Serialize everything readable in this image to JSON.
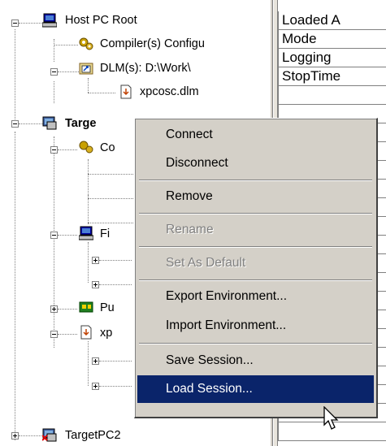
{
  "tree": {
    "host_root": "Host PC Root",
    "compiler_config": "Compiler(s) Configu",
    "dlm_folder": "DLM(s): D:\\Work\\",
    "dlm_file": "xpcosc.dlm",
    "target_root": "Targe",
    "target_child_c": "Co",
    "target_child_fi": "Fi",
    "target_child_pu": "Pu",
    "target_child_xp": "xp",
    "target_pc2": "TargetPC2"
  },
  "grid": {
    "rows": [
      "Loaded A",
      "Mode",
      "Logging",
      "StopTime"
    ]
  },
  "context_menu": {
    "items": [
      {
        "label": "Connect",
        "state": "normal"
      },
      {
        "label": "Disconnect",
        "state": "normal"
      },
      {
        "label": "Remove",
        "state": "normal"
      },
      {
        "label": "Rename",
        "state": "disabled"
      },
      {
        "label": "Set As Default",
        "state": "disabled"
      },
      {
        "label": "Export Environment...",
        "state": "normal"
      },
      {
        "label": "Import Environment...",
        "state": "normal"
      },
      {
        "label": "Save Session...",
        "state": "normal"
      },
      {
        "label": "Load Session...",
        "state": "highlighted"
      }
    ]
  },
  "colors": {
    "menu_bg": "#d4d0c8",
    "highlight": "#0a246a",
    "disabled_text": "#808080"
  }
}
